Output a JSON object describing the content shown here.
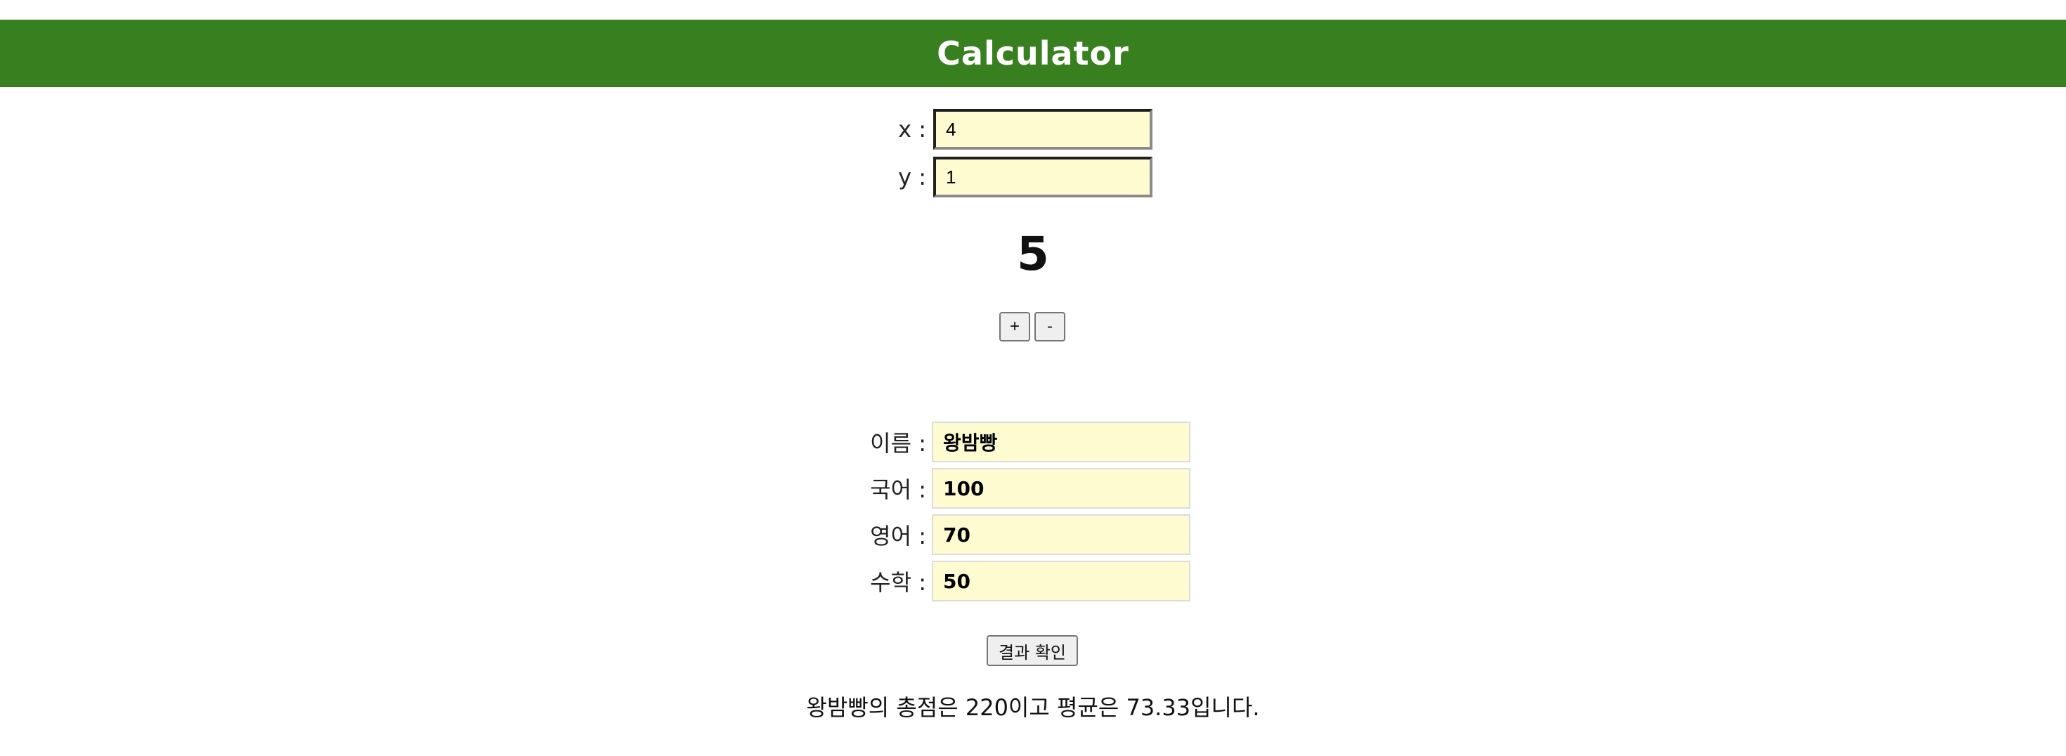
{
  "header": {
    "title": "Calculator"
  },
  "calculator": {
    "x_label": "x :",
    "x_value": "4",
    "y_label": "y :",
    "y_value": "1",
    "result": "5",
    "plus_label": "+",
    "minus_label": "-"
  },
  "grades": {
    "name_label": "이름 :",
    "name_value": "왕밤빵",
    "korean_label": "국어 :",
    "korean_value": "100",
    "english_label": "영어 :",
    "english_value": "70",
    "math_label": "수학 :",
    "math_value": "50",
    "submit_label": "결과 확인",
    "summary": "왕밤빵의 총점은 220이고 평균은 73.33입니다."
  },
  "colors": {
    "header_bg": "#38801f",
    "input_bg": "#fffbd0"
  }
}
